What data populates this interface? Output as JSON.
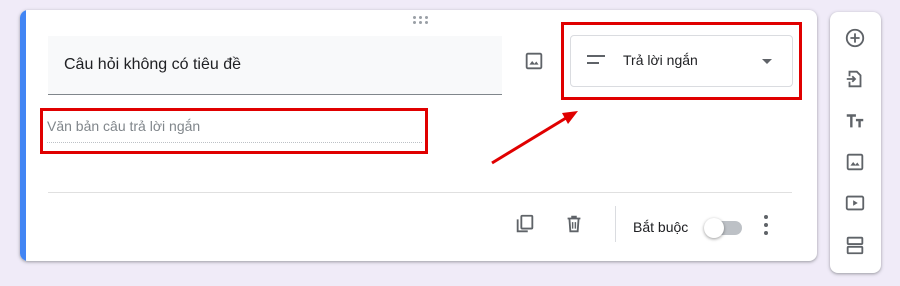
{
  "question": {
    "title": "Câu hỏi không có tiêu đề"
  },
  "question_type": {
    "selected": "Trả lời ngắn"
  },
  "answer": {
    "placeholder": "Văn bản câu trả lời ngắn"
  },
  "footer": {
    "required_label": "Bắt buộc",
    "required_on": false
  },
  "icons": {
    "drag": "drag-handle-icon",
    "image": "image-icon",
    "short_answer": "short-text-icon",
    "dropdown": "chevron-down-icon",
    "duplicate": "copy-icon",
    "delete": "trash-icon",
    "more": "more-vert-icon",
    "sidebar": [
      "add-circle-icon",
      "import-icon",
      "title-icon",
      "image-icon",
      "video-icon",
      "section-icon"
    ]
  },
  "colors": {
    "accent": "#4285f4",
    "background": "#f0ebf8",
    "annotation": "#e00000"
  }
}
